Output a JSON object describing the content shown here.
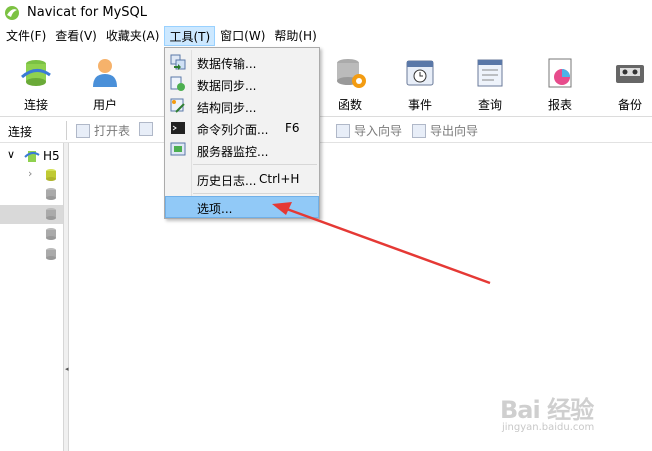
{
  "window": {
    "title": "Navicat for MySQL"
  },
  "menubar": {
    "items": [
      "文件(F)",
      "查看(V)",
      "收藏夹(A)",
      "工具(T)",
      "窗口(W)",
      "帮助(H)"
    ],
    "active": "工具(T)"
  },
  "toolbar": {
    "buttons": [
      {
        "label": "连接",
        "icon": "connection-icon"
      },
      {
        "label": "用户",
        "icon": "user-icon"
      },
      {
        "label": "函数",
        "icon": "function-icon"
      },
      {
        "label": "事件",
        "icon": "event-icon"
      },
      {
        "label": "查询",
        "icon": "query-icon"
      },
      {
        "label": "报表",
        "icon": "report-icon"
      },
      {
        "label": "备份",
        "icon": "backup-icon"
      }
    ]
  },
  "subbar": {
    "label": "连接",
    "buttons": [
      {
        "label": "打开表",
        "enabled": false
      },
      {
        "label": "导入向导",
        "enabled": false
      },
      {
        "label": "导出向导",
        "enabled": false
      }
    ]
  },
  "tree": {
    "root": {
      "label": "H5",
      "expanded": true
    },
    "children_count": 5,
    "selected_index": 2
  },
  "tools_menu": {
    "items": [
      {
        "label": "数据传输...",
        "shortcut": "",
        "icon": "data-transfer-icon"
      },
      {
        "label": "数据同步...",
        "shortcut": "",
        "icon": "data-sync-icon"
      },
      {
        "label": "结构同步...",
        "shortcut": "",
        "icon": "structure-sync-icon"
      },
      {
        "label": "命令列介面...",
        "shortcut": "F6",
        "icon": "console-icon"
      },
      {
        "label": "服务器监控...",
        "shortcut": "",
        "icon": "server-monitor-icon"
      },
      {
        "label": "历史日志...",
        "shortcut": "Ctrl+H",
        "icon": ""
      },
      {
        "label": "选项...",
        "shortcut": "",
        "icon": ""
      }
    ],
    "highlighted": "选项..."
  },
  "watermark": {
    "brand": "Bai 经验",
    "url": "jingyan.baidu.com"
  },
  "colors": {
    "menu_highlight": "#91c9f7",
    "active_menu": "#cce8ff",
    "arrow": "#e53935"
  }
}
